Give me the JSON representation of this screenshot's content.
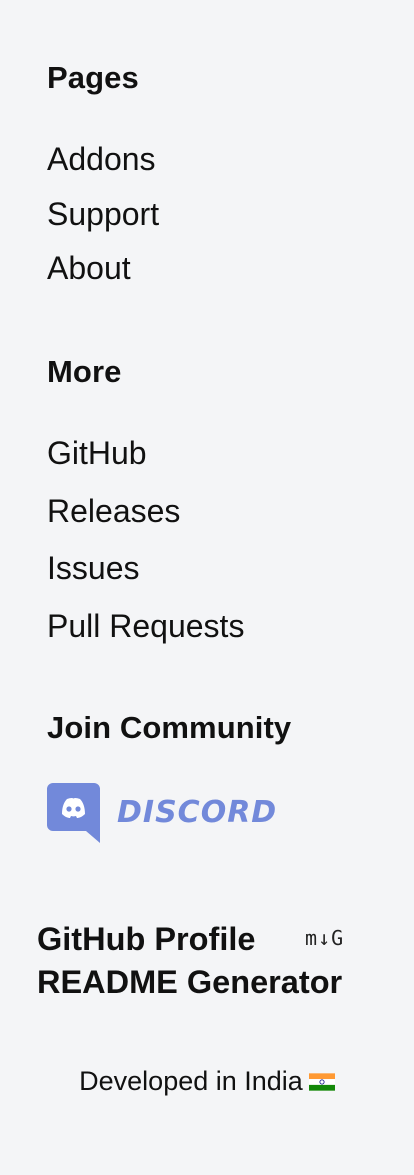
{
  "pages": {
    "heading": "Pages",
    "links": [
      "Addons",
      "Support",
      "About"
    ]
  },
  "more": {
    "heading": "More",
    "links": [
      "GitHub",
      "Releases",
      "Issues",
      "Pull Requests"
    ]
  },
  "community": {
    "heading": "Join Community",
    "discord_label": "DISCORD",
    "discord_icon": "discord-icon",
    "discord_color": "#7289da"
  },
  "brand": {
    "title_line1": "GitHub Profile",
    "title_line2": "README Generator",
    "logo_text": "m↓G"
  },
  "footer": {
    "developed_text": "Developed in India",
    "flag_icon": "india-flag-icon"
  }
}
